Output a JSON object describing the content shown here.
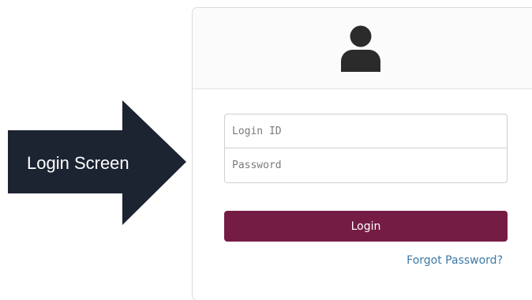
{
  "callout": {
    "label": "Login Screen"
  },
  "login": {
    "login_id_placeholder": "Login ID",
    "password_placeholder": "Password",
    "button_label": "Login",
    "forgot_password": "Forgot Password?",
    "user_icon": "user-icon"
  },
  "colors": {
    "arrow": "#1c2331",
    "button": "#741c44",
    "link": "#3c78a6",
    "card_border": "#dcdcdc"
  }
}
